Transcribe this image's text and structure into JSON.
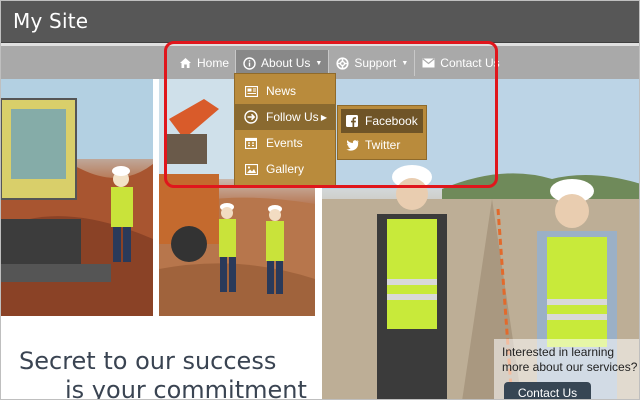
{
  "site": {
    "title": "My Site"
  },
  "nav": {
    "items": [
      {
        "label": "Home",
        "icon": "home-icon"
      },
      {
        "label": "About Us",
        "icon": "info-icon",
        "active": true,
        "has_dropdown": true
      },
      {
        "label": "Support",
        "icon": "lifebuoy-icon",
        "has_dropdown": true
      },
      {
        "label": "Contact Us",
        "icon": "envelope-icon"
      }
    ]
  },
  "dropdown": {
    "items": [
      {
        "label": "News",
        "icon": "newspaper-icon"
      },
      {
        "label": "Follow Us",
        "icon": "arrow-circle-icon",
        "active": true,
        "has_submenu": true
      },
      {
        "label": "Events",
        "icon": "calendar-icon"
      },
      {
        "label": "Gallery",
        "icon": "picture-icon"
      }
    ]
  },
  "submenu": {
    "items": [
      {
        "label": "Facebook",
        "icon": "facebook-icon",
        "active": true
      },
      {
        "label": "Twitter",
        "icon": "twitter-icon"
      }
    ]
  },
  "main": {
    "tagline_line1": "Secret to our success",
    "tagline_line2": "is your commitment",
    "cta_text": "Interested in learning more about our services?",
    "cta_button": "Contact Us"
  },
  "colors": {
    "header_bg": "#575757",
    "nav_bg": "#a9a9a9",
    "dropdown_bg": "#b98b3c",
    "highlight": "#e0161c",
    "cta_button_bg": "#374654"
  }
}
